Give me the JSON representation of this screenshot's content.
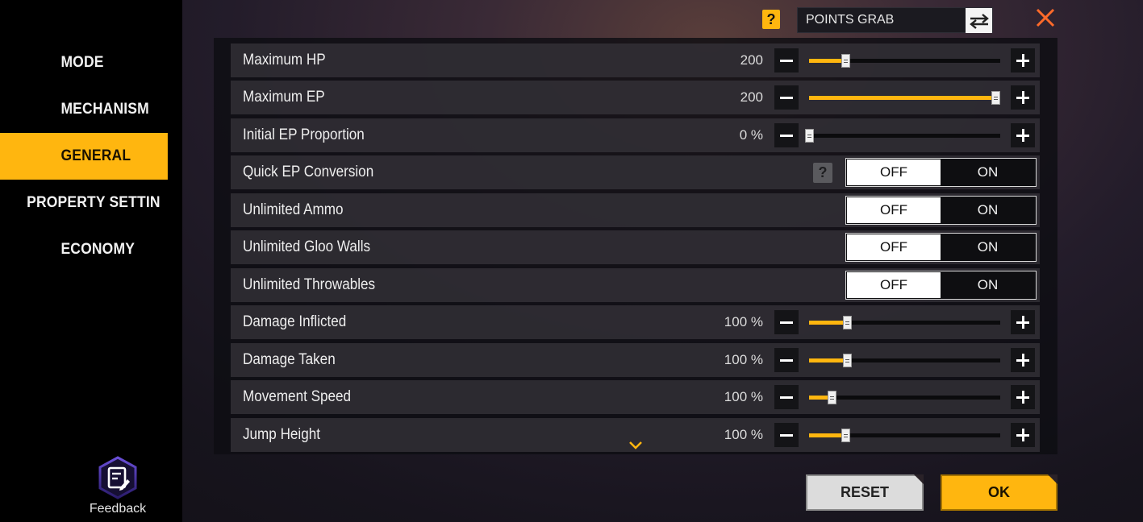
{
  "sidebar": {
    "items": [
      {
        "label": "MODE"
      },
      {
        "label": "MECHANISM"
      },
      {
        "label": "GENERAL"
      },
      {
        "label": "PROPERTY SETTIN"
      },
      {
        "label": "ECONOMY"
      }
    ],
    "active_index": 2,
    "feedback_label": "Feedback"
  },
  "topbar": {
    "help_mark": "?",
    "mode_value": "POINTS GRAB",
    "swap_icon": "swap-arrows-icon",
    "close_icon": "close-icon"
  },
  "settings": {
    "rows": [
      {
        "label": "Maximum HP",
        "type": "slider",
        "value": "200",
        "level": 0.19
      },
      {
        "label": "Maximum EP",
        "type": "slider",
        "value": "200",
        "level": 1.0
      },
      {
        "label": "Initial EP Proportion",
        "type": "slider",
        "value": "0 %",
        "level": 0.0
      },
      {
        "label": "Quick EP Conversion",
        "type": "toggle",
        "off": "OFF",
        "on": "ON",
        "selected": "OFF",
        "help": "?"
      },
      {
        "label": "Unlimited Ammo",
        "type": "toggle",
        "off": "OFF",
        "on": "ON",
        "selected": "OFF"
      },
      {
        "label": "Unlimited Gloo Walls",
        "type": "toggle",
        "off": "OFF",
        "on": "ON",
        "selected": "OFF"
      },
      {
        "label": "Unlimited Throwables",
        "type": "toggle",
        "off": "OFF",
        "on": "ON",
        "selected": "OFF"
      },
      {
        "label": "Damage Inflicted",
        "type": "slider",
        "value": "100 %",
        "level": 0.2
      },
      {
        "label": "Damage Taken",
        "type": "slider",
        "value": "100 %",
        "level": 0.2
      },
      {
        "label": "Movement Speed",
        "type": "slider",
        "value": "100 %",
        "level": 0.12
      },
      {
        "label": "Jump Height",
        "type": "slider",
        "value": "100 %",
        "level": 0.19
      }
    ]
  },
  "footer": {
    "reset_label": "RESET",
    "ok_label": "OK"
  },
  "colors": {
    "accent": "#ffb60f",
    "sidebar_bg": "#000000",
    "row_bg": "#343239"
  }
}
